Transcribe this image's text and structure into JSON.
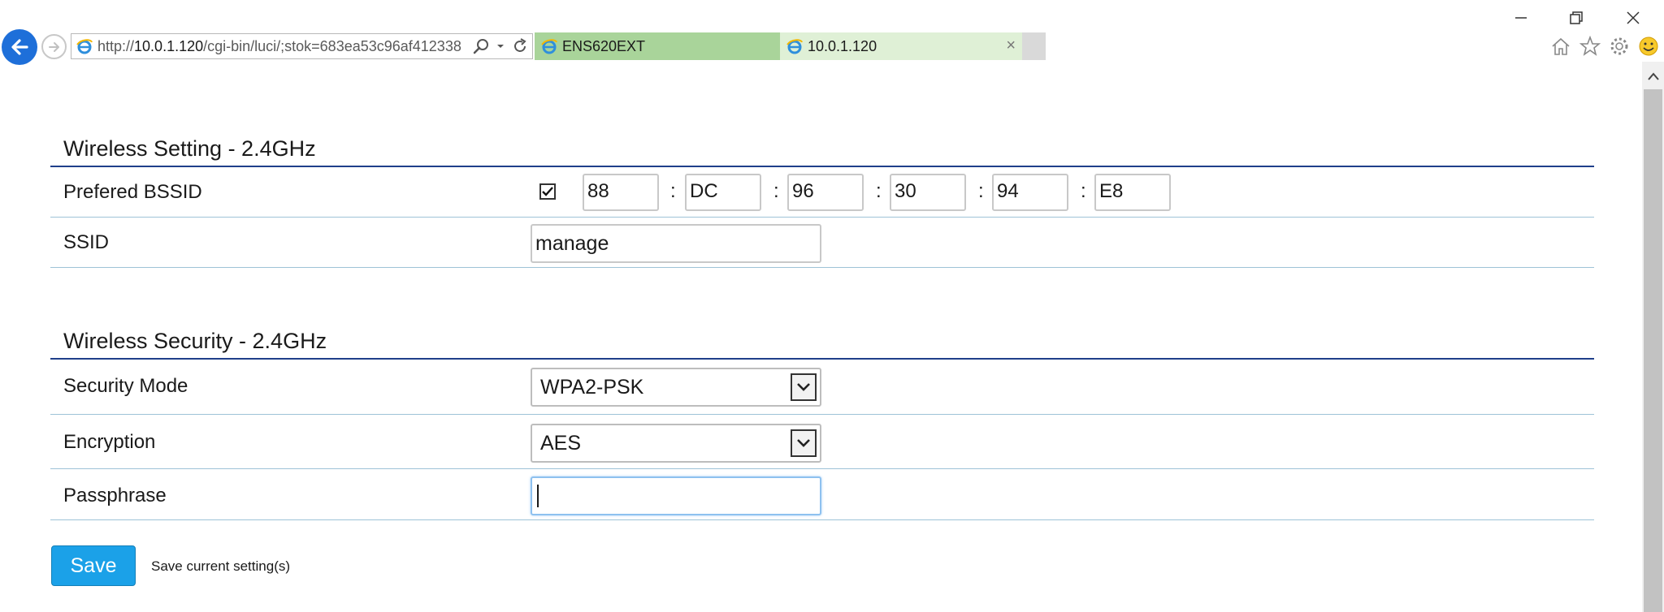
{
  "browser": {
    "url_prefix": "http://",
    "url_host": "10.0.1.120",
    "url_path": "/cgi-bin/luci/;stok=683ea53c96af412338",
    "tabs": [
      {
        "label": "ENS620EXT"
      },
      {
        "label": "10.0.1.120"
      }
    ],
    "tab_close_glyph": "×"
  },
  "wireless_setting": {
    "title": "Wireless Setting - 2.4GHz",
    "bssid_label": "Prefered BSSID",
    "bssid_checked": true,
    "bssid_octets": [
      "88",
      "DC",
      "96",
      "30",
      "94",
      "E8"
    ],
    "separator": ":",
    "ssid_label": "SSID",
    "ssid_value": "manage"
  },
  "wireless_security": {
    "title": "Wireless Security - 2.4GHz",
    "mode_label": "Security Mode",
    "mode_value": "WPA2-PSK",
    "encryption_label": "Encryption",
    "encryption_value": "AES",
    "passphrase_label": "Passphrase",
    "passphrase_value": ""
  },
  "actions": {
    "save_label": "Save",
    "save_hint": "Save current setting(s)"
  },
  "colors": {
    "accent_blue": "#1ba1e8",
    "section_rule": "#1f3f8a",
    "row_rule": "#9ec3d7",
    "tab_active": "#a9d49a"
  },
  "icons": [
    "back-arrow-icon",
    "forward-arrow-icon",
    "ie-icon",
    "search-icon",
    "dropdown-icon",
    "refresh-icon",
    "minimize-icon",
    "restore-icon",
    "close-icon",
    "home-icon",
    "star-icon",
    "gear-icon",
    "smiley-icon",
    "check-icon",
    "chevron-down-icon",
    "scroll-up-icon"
  ]
}
